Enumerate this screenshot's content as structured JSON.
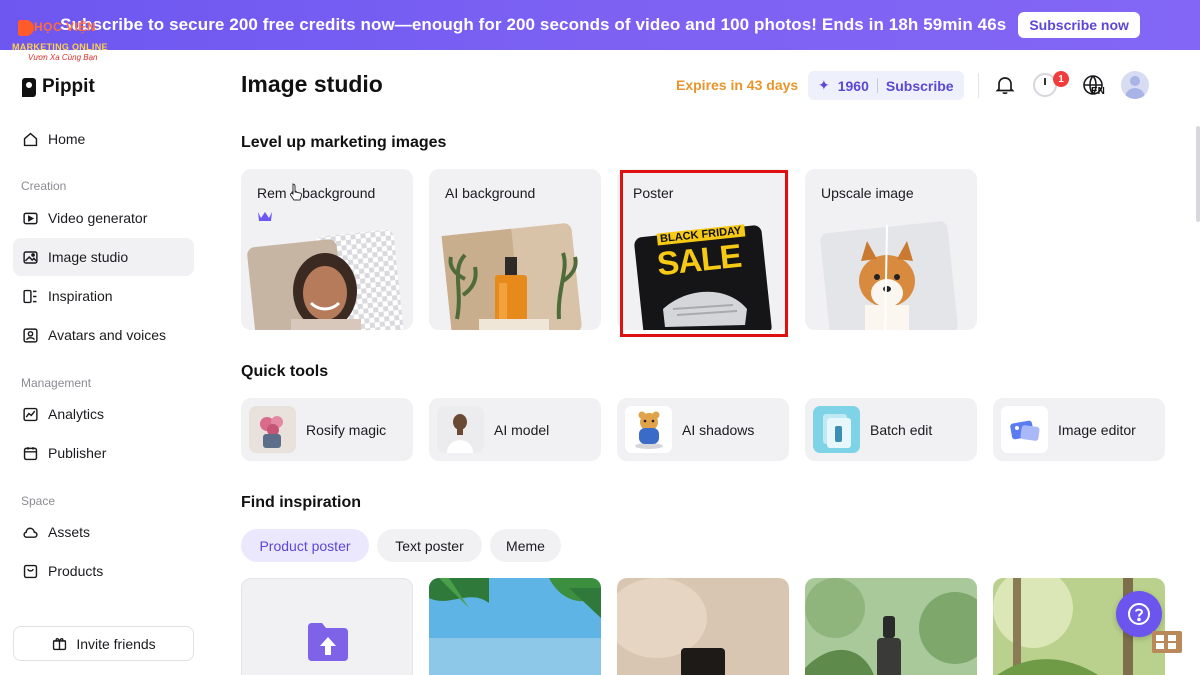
{
  "banner": {
    "text": "Subscribe to secure 200 free credits now—enough for 200 seconds of video and 100 photos! Ends in 18h 59min 46s",
    "button": "Subscribe now"
  },
  "watermark": {
    "line1": "HỌC VIỆN",
    "line2": "MARKETING ONLINE",
    "line3": "Vươn Xa Cùng Bạn"
  },
  "brand": {
    "name": "Pippit"
  },
  "sidebar": {
    "home": "Home",
    "creation_label": "Creation",
    "creation": [
      "Video generator",
      "Image studio",
      "Inspiration",
      "Avatars and voices"
    ],
    "management_label": "Management",
    "management": [
      "Analytics",
      "Publisher"
    ],
    "space_label": "Space",
    "space": [
      "Assets",
      "Products"
    ],
    "invite": "Invite friends"
  },
  "header": {
    "title": "Image studio",
    "expires": "Expires in 43 days",
    "credits": "1960",
    "subscribe": "Subscribe",
    "notification_badge": "1",
    "language": "EN"
  },
  "sections": {
    "level_up": "Level up marketing images",
    "quick_tools": "Quick tools",
    "find_inspiration": "Find inspiration"
  },
  "feature_cards": [
    {
      "label": "Remove background",
      "shown_label": "Rem  e background"
    },
    {
      "label": "AI background"
    },
    {
      "label": "Poster",
      "poster_line1": "BLACK FRIDAY",
      "poster_line2": "SALE"
    },
    {
      "label": "Upscale image"
    }
  ],
  "quick_tools": [
    "Rosify magic",
    "AI model",
    "AI shadows",
    "Batch edit",
    "Image editor"
  ],
  "filters": [
    "Product poster",
    "Text poster",
    "Meme"
  ],
  "colors": {
    "accent": "#6d57f0",
    "highlight": "#e01010",
    "expires": "#e8962b"
  }
}
